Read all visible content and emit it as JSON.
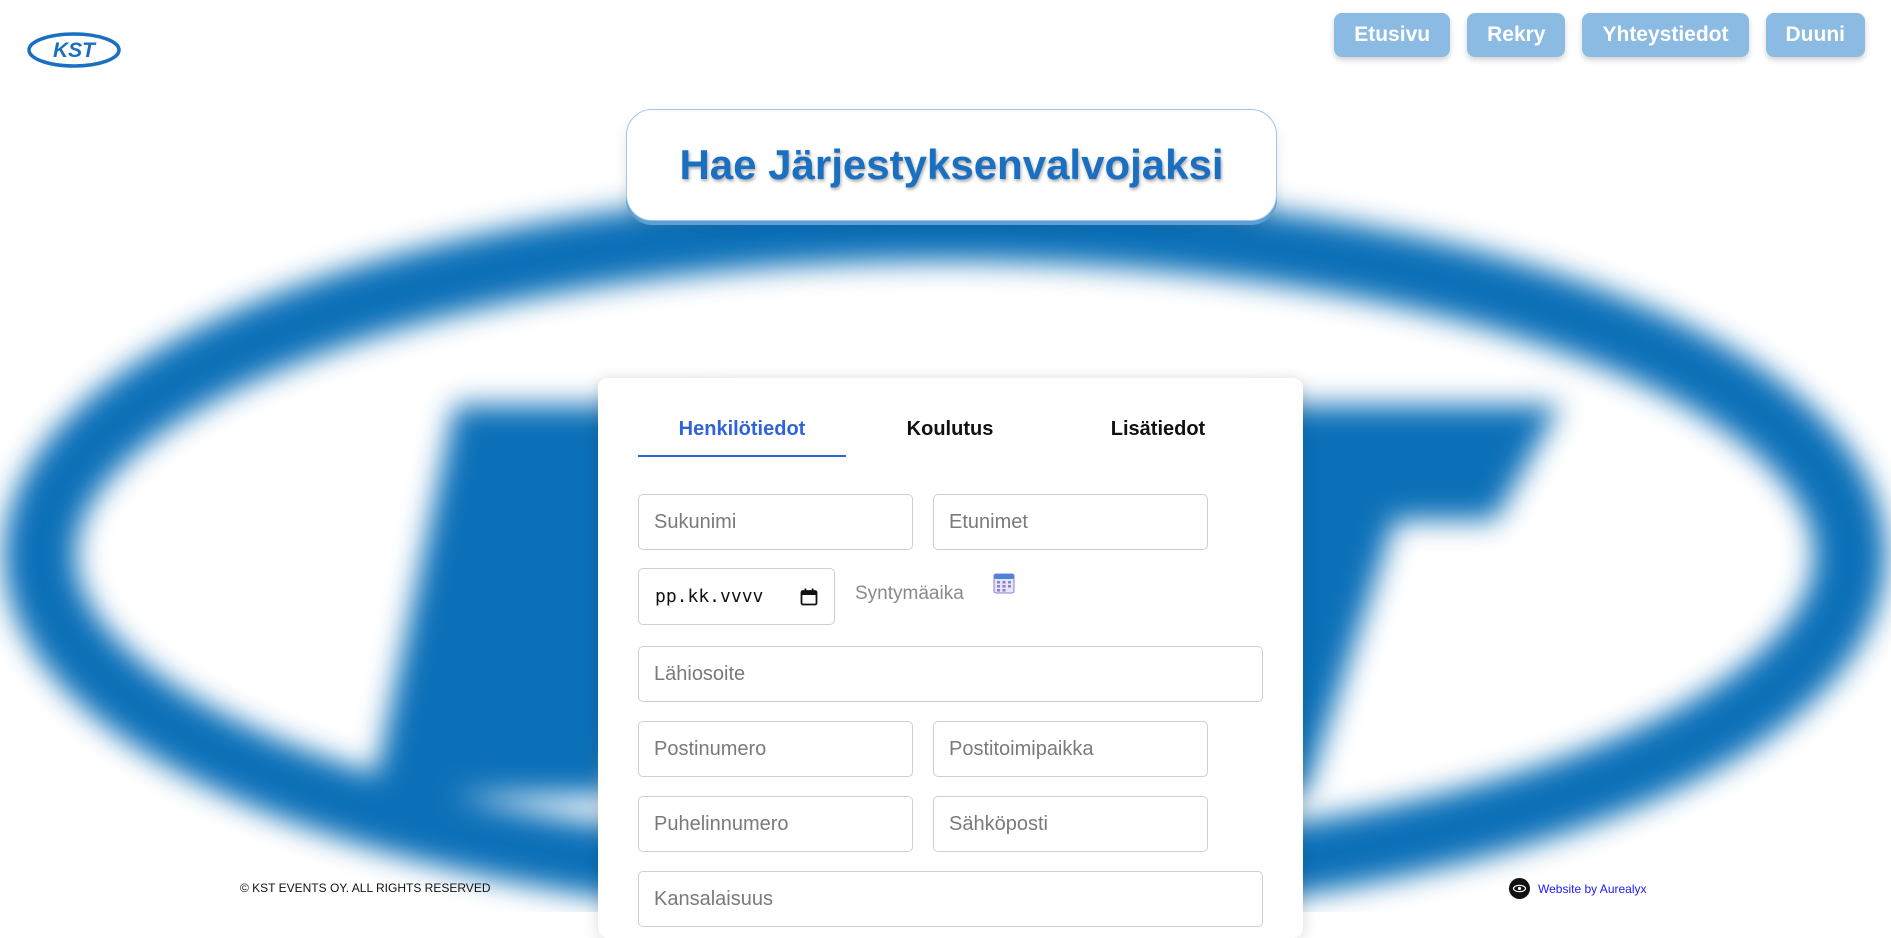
{
  "brand": {
    "logo_text": "KST",
    "color": "#1a6fc1"
  },
  "nav": {
    "items": [
      {
        "label": "Etusivu"
      },
      {
        "label": "Rekry"
      },
      {
        "label": "Yhteystiedot"
      },
      {
        "label": "Duuni"
      }
    ],
    "button_color": "#8bbbe2"
  },
  "title": "Hae Järjestyksenvalvojaksi",
  "tabs": [
    {
      "label": "Henkilötiedot",
      "active": true
    },
    {
      "label": "Koulutus",
      "active": false
    },
    {
      "label": "Lisätiedot",
      "active": false
    }
  ],
  "form": {
    "sukunimi_placeholder": "Sukunimi",
    "etunimet_placeholder": "Etunimet",
    "date_value": "pp.kk.vvvv",
    "syntymaaika_label": "Syntymäaika",
    "lahiosoite_placeholder": "Lähiosoite",
    "postinumero_placeholder": "Postinumero",
    "postitoimipaikka_placeholder": "Postitoimipaikka",
    "puhelinnumero_placeholder": "Puhelinnumero",
    "sahkoposti_placeholder": "Sähköposti",
    "kansalaisuus_placeholder": "Kansalaisuus"
  },
  "footer": {
    "copyright": "© KST EVENTS OY. ALL RIGHTS RESERVED",
    "credit": "Website by Aurealyx"
  },
  "icons": {
    "calendar": "calendar-icon",
    "date_picker": "calendar-picker-icon",
    "credit_logo": "eye-logo-icon"
  }
}
